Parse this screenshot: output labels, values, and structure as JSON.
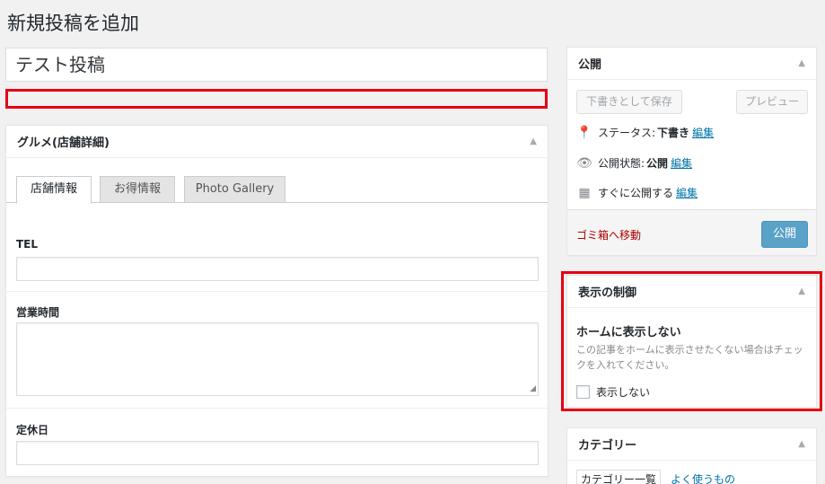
{
  "page": {
    "title": "新規投稿を追加"
  },
  "post": {
    "title_value": "テスト投稿"
  },
  "gourmet": {
    "title": "グルメ(店舗詳細)",
    "tabs": [
      "店舗情報",
      "お得情報",
      "Photo Gallery"
    ],
    "active_tab": "店舗情報",
    "fields": {
      "tel_label": "TEL",
      "hours_label": "営業時間",
      "holiday_label": "定休日"
    }
  },
  "publish": {
    "title": "公開",
    "save_draft": "下書きとして保存",
    "preview": "プレビュー",
    "status_label": "ステータス:",
    "status_value": "下書き",
    "visibility_label": "公開状態:",
    "visibility_value": "公開",
    "schedule_label": "すぐに公開する",
    "edit": "編集",
    "trash": "ゴミ箱へ移動",
    "publish_button": "公開"
  },
  "display_control": {
    "title": "表示の制御",
    "heading": "ホームに表示しない",
    "description": "この記事をホームに表示させたくない場合はチェックを入れてください。",
    "checkbox_label": "表示しない",
    "checked": false
  },
  "category": {
    "title": "カテゴリー",
    "tab_all": "カテゴリー一覧",
    "tab_popular": "よく使うもの"
  },
  "colors": {
    "accent": "#0073aa",
    "highlight_border": "#e60012",
    "publish_button": "#5ba2c8",
    "trash": "#aa0000"
  },
  "icons": {
    "toggle": "triangle-up-icon",
    "status": "pin-icon",
    "visibility": "eye-icon",
    "schedule": "calendar-icon"
  }
}
